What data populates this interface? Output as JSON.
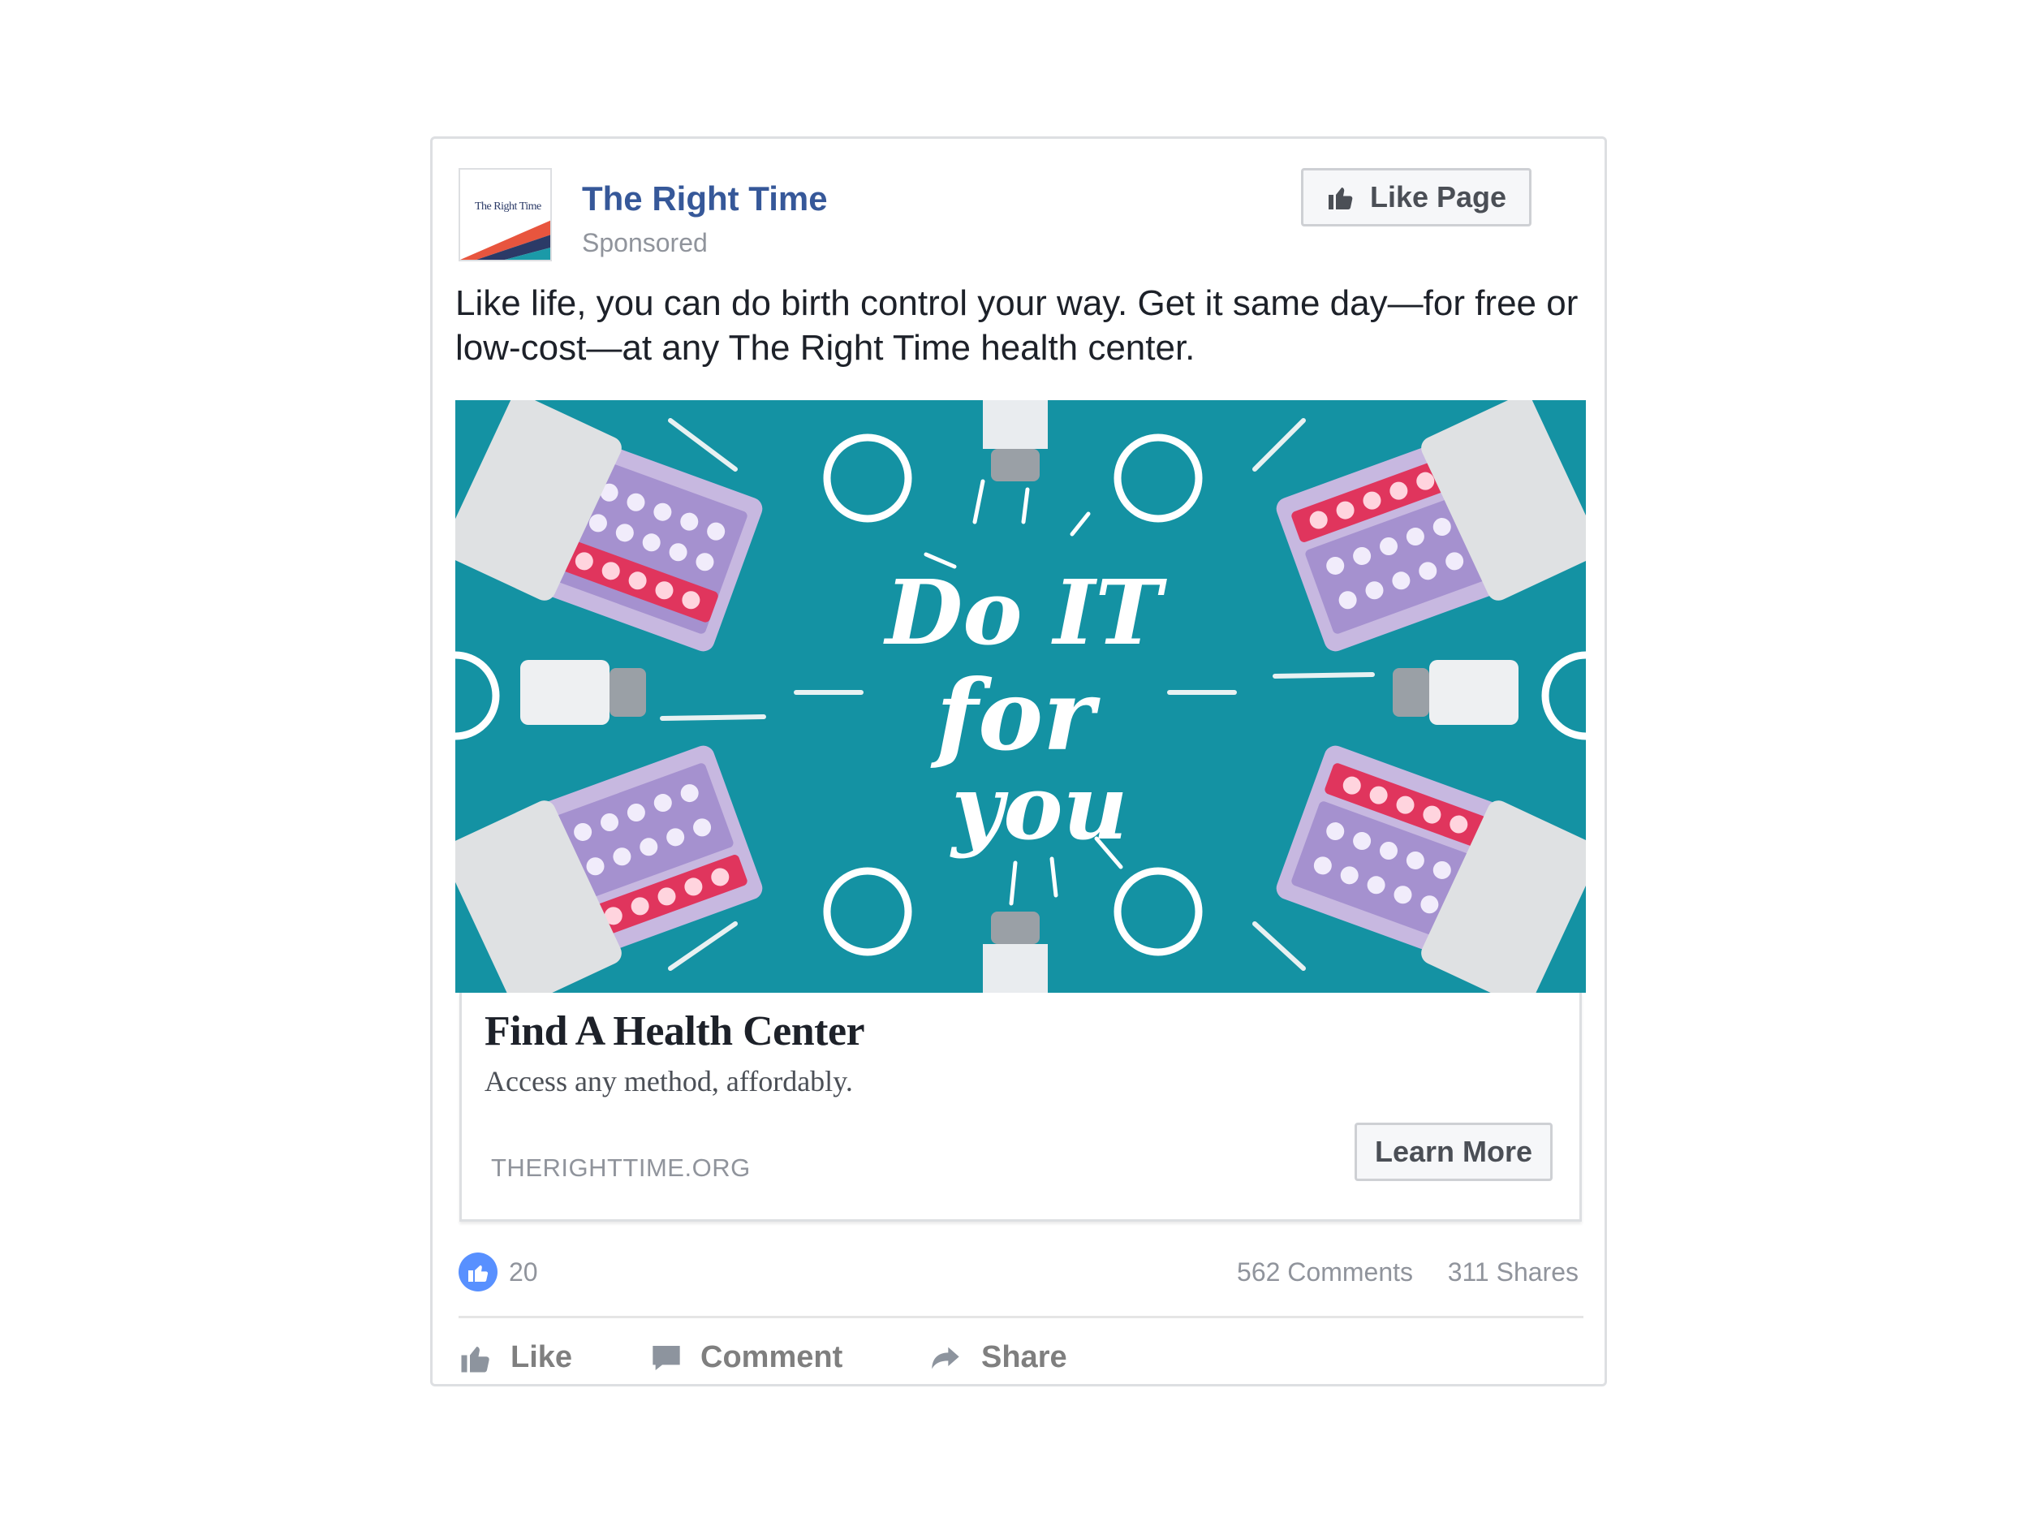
{
  "post": {
    "page_name": "The Right Time",
    "sponsored_label": "Sponsored",
    "like_page_label": "Like Page",
    "avatar_text": "The Right Time",
    "text": "Like life, you can do birth control your way. Get it same day—for free or low-cost—at any The Right Time health center."
  },
  "ad": {
    "image_lettering": "Do it for you",
    "background_color": "#1492a3",
    "headline": "Find A Health Center",
    "description": "Access any method, affordably.",
    "domain": "THERIGHTTIME.ORG",
    "cta_label": "Learn More"
  },
  "stats": {
    "likes": "20",
    "comments": "562 Comments",
    "shares": "311 Shares"
  },
  "actions": {
    "like": "Like",
    "comment": "Comment",
    "share": "Share"
  },
  "colors": {
    "brand_link": "#365899",
    "muted": "#90949c",
    "like_blue": "#5890ff"
  }
}
